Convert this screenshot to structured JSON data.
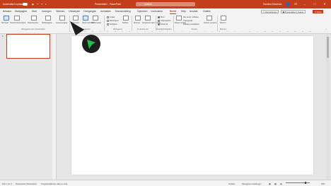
{
  "titlebar": {
    "autosave": "Automatisch opslaan",
    "doc_title": "Presentatie1 - PowerPoint",
    "search_placeholder": "Zoeken",
    "user": "Karolina Kłosińska"
  },
  "tabs": [
    "Bestand",
    "Startpagina",
    "Start",
    "Invoegen",
    "Tekenen",
    "Ontwerpen",
    "Overgangen",
    "Animaties",
    "Diavoorstelling",
    "Opnemen",
    "Controleren",
    "Beeld",
    "Help",
    "Acrobat",
    "Grafiek"
  ],
  "active_tab": "Beeld",
  "top_buttons": {
    "comments": "Opmerkingen",
    "record": "Presentatie in Teams",
    "share": "Delen"
  },
  "ribbon": {
    "views": [
      "Normaal",
      "Overzichtsweergave",
      "Diasorteerder",
      "Notitiepagina",
      "Leesweergave"
    ],
    "views_group": "Weergaven voor presentaties",
    "master_views": [
      "Diamodel",
      "Hand-outmodel",
      "Notitiemodel"
    ],
    "master_group": "Modelweergaven",
    "show_items": [
      "Liniaal",
      "Rasterlijnen",
      "Hulplijnen"
    ],
    "show_group": "Weergeven",
    "notes": "Notities",
    "zoom_items": [
      "Zoomen",
      "Aanpassen aan venster"
    ],
    "zoom_group": "In-/uitzoomen",
    "color_items": [
      "Kleur",
      "Grijswaarden",
      "Zwart-wit"
    ],
    "color_group": "Kleur/grijswaarden",
    "window_items": [
      "Nieuw venster",
      "Alle venst. schikken",
      "Trapsgewijs",
      "Splitsing verplaatsen"
    ],
    "switch_windows": "Andere vensters",
    "window_group": "Venster",
    "macros": "Macro's",
    "macros_group": "Macro's"
  },
  "thumbnail": {
    "number": "1"
  },
  "ruler_ticks": [
    "16",
    "15",
    "14",
    "13",
    "12",
    "11",
    "10",
    "9",
    "8",
    "7",
    "6",
    "5",
    "4",
    "3",
    "2",
    "1",
    "0",
    "1",
    "2",
    "3",
    "4",
    "5",
    "6",
    "7",
    "8",
    "9",
    "10",
    "11",
    "12",
    "13",
    "14",
    "15",
    "16"
  ],
  "statusbar": {
    "slide_info": "Dia 1 van 1",
    "language": "Nederlands (Nederland)",
    "accessibility": "Toegankelijkheid: alles in orde",
    "notes": "Notities",
    "display_settings": "Weergave-instellingen",
    "zoom": "53%"
  }
}
